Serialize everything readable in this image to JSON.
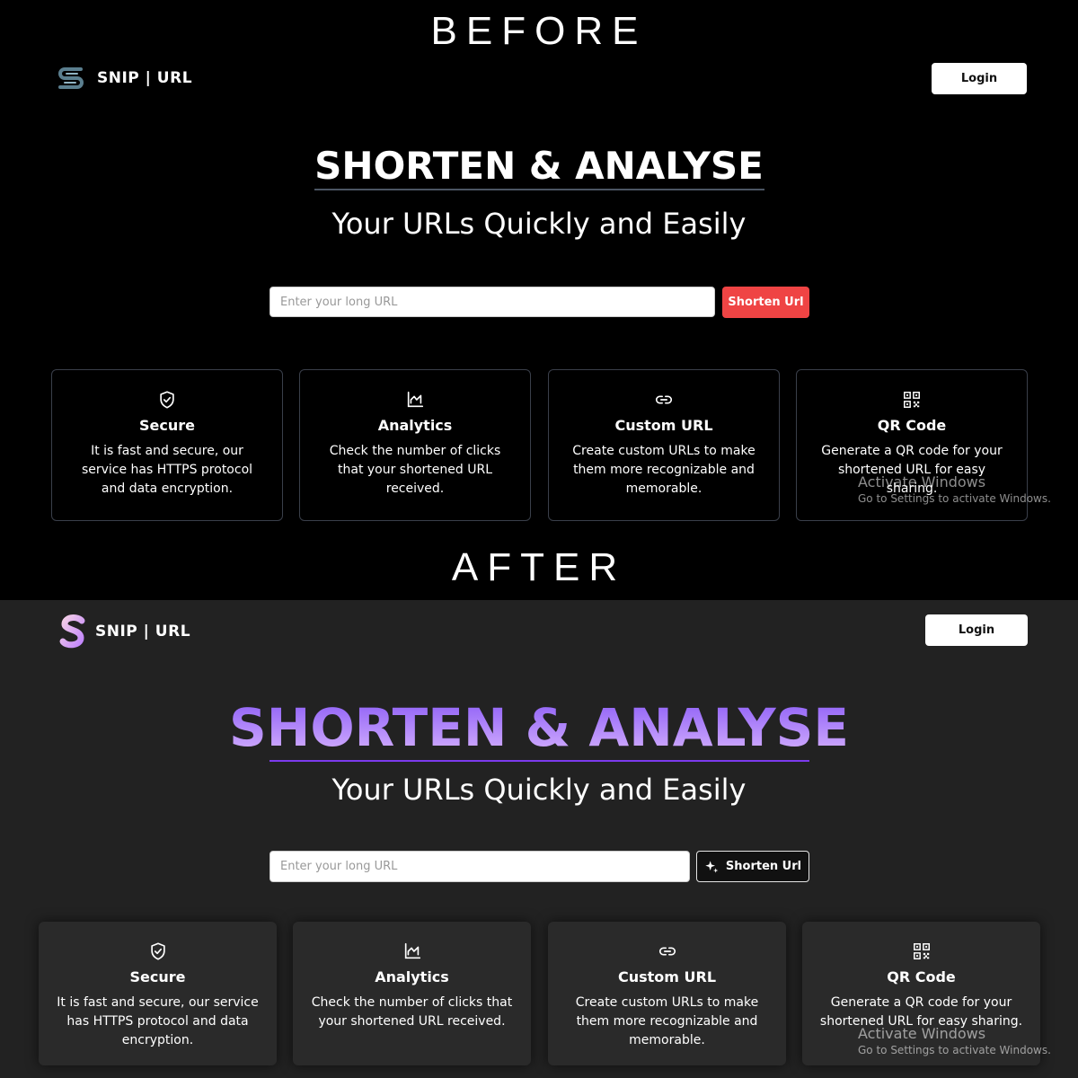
{
  "labels": {
    "before": "BEFORE",
    "after": "AFTER"
  },
  "before": {
    "brand": "SNIP | URL",
    "login": "Login",
    "hero_title": "SHORTEN & ANALYSE",
    "hero_subtitle": "Your URLs Quickly and Easily",
    "input_placeholder": "Enter your long URL",
    "shorten_label": "Shorten Url",
    "accent_color": "#ef4444",
    "cards": [
      {
        "icon": "shield-check-icon",
        "title": "Secure",
        "desc": "It is fast and secure, our service has HTTPS protocol and data encryption."
      },
      {
        "icon": "chart-icon",
        "title": "Analytics",
        "desc": "Check the number of clicks that your shortened URL received."
      },
      {
        "icon": "link-icon",
        "title": "Custom URL",
        "desc": "Create custom URLs to make them more recognizable and memorable."
      },
      {
        "icon": "qr-code-icon",
        "title": "QR Code",
        "desc": "Generate a QR code for your shortened URL for easy sharing."
      }
    ]
  },
  "after": {
    "brand": "SNIP | URL",
    "login": "Login",
    "hero_title": "SHORTEN & ANALYSE",
    "hero_subtitle": "Your URLs Quickly and Easily",
    "input_placeholder": "Enter your long URL",
    "shorten_label": "Shorten Url",
    "title_gradient": [
      "#8b5cf6",
      "#d8b4fe"
    ],
    "cards": [
      {
        "icon": "shield-check-icon",
        "title": "Secure",
        "desc": "It is fast and secure, our service has HTTPS protocol and data encryption."
      },
      {
        "icon": "chart-icon",
        "title": "Analytics",
        "desc": "Check the number of clicks that your shortened URL received."
      },
      {
        "icon": "link-icon",
        "title": "Custom URL",
        "desc": "Create custom URLs to make them more recognizable and memorable."
      },
      {
        "icon": "qr-code-icon",
        "title": "QR Code",
        "desc": "Generate a QR code for your shortened URL for easy sharing."
      }
    ]
  },
  "watermark": {
    "title": "Activate Windows",
    "subtitle": "Go to Settings to activate Windows."
  }
}
